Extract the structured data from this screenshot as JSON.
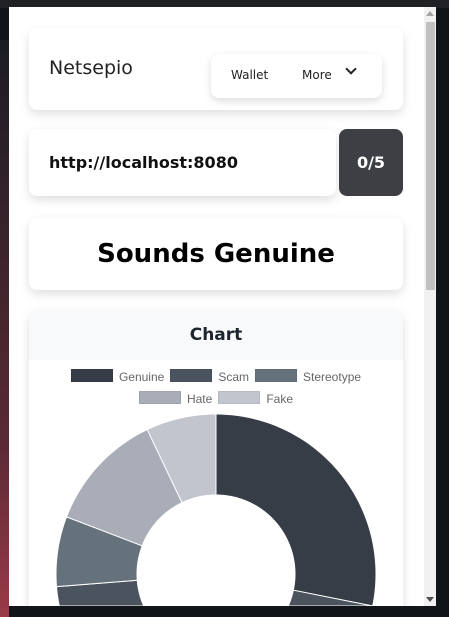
{
  "header": {
    "brand": "Netsepio",
    "wallet_label": "Wallet",
    "more_label": "More"
  },
  "site": {
    "url": "http://localhost:8080",
    "score": "0/5"
  },
  "verdict": "Sounds Genuine",
  "chart_section": {
    "title": "Chart"
  },
  "chart_data": {
    "type": "doughnut",
    "legend_position": "top",
    "categories": [
      "Genuine",
      "Scam",
      "Stereotype",
      "Hate",
      "Fake"
    ],
    "values": [
      28,
      45,
      7,
      12,
      7
    ],
    "colors": [
      "#363d47",
      "#4b545e",
      "#65717b",
      "#a9adb8",
      "#c2c5cd"
    ]
  }
}
